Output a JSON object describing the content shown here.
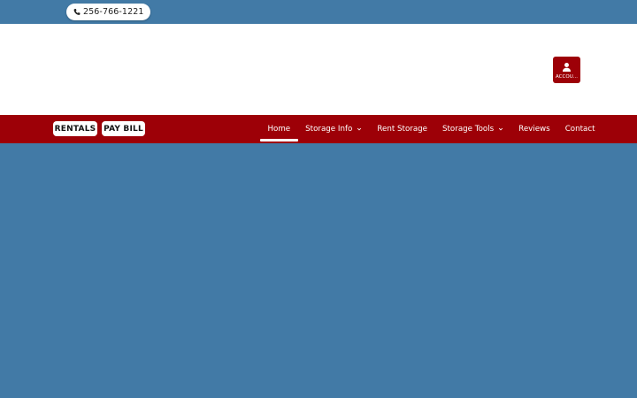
{
  "topbar": {
    "phone": "256-766-1221",
    "phone_icon": "phone-icon"
  },
  "header": {
    "account_label": "ACCOU...",
    "account_icon": "user-icon"
  },
  "navbar": {
    "quick_links": [
      {
        "label": "RENTALS"
      },
      {
        "label": "PAY BILL"
      }
    ],
    "menu": [
      {
        "label": "Home",
        "active": true
      },
      {
        "label": "Storage Info",
        "has_dropdown": true
      },
      {
        "label": "Rent Storage"
      },
      {
        "label": "Storage Tools",
        "has_dropdown": true
      },
      {
        "label": "Reviews"
      },
      {
        "label": "Contact"
      }
    ]
  },
  "colors": {
    "brand_blue": "#427aa6",
    "brand_red": "#9d0007",
    "white": "#ffffff"
  }
}
